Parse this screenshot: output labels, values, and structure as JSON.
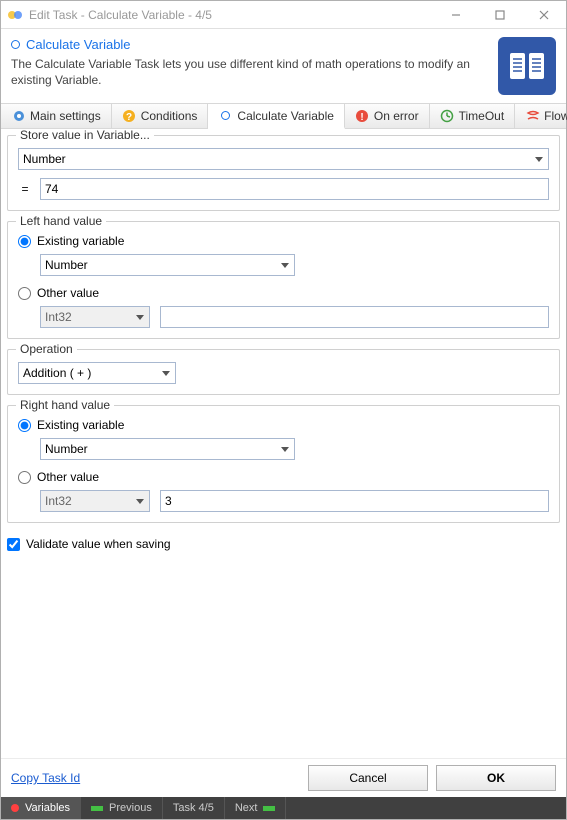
{
  "window": {
    "title": "Edit Task - Calculate Variable - 4/5"
  },
  "header": {
    "title": "Calculate Variable",
    "description": "The Calculate Variable Task lets you use different kind of math operations to modify an existing Variable."
  },
  "tabs": {
    "main": "Main settings",
    "conditions": "Conditions",
    "calc": "Calculate Variable",
    "onerror": "On error",
    "timeout": "TimeOut",
    "flow": "Flow"
  },
  "store": {
    "legend": "Store value in Variable...",
    "variable": "Number",
    "eq": "=",
    "value": "74"
  },
  "left": {
    "legend": "Left hand value",
    "existing_label": "Existing variable",
    "other_label": "Other value",
    "existing_var": "Number",
    "other_type": "Int32",
    "other_value": ""
  },
  "operation": {
    "legend": "Operation",
    "value": "Addition ( + )"
  },
  "right": {
    "legend": "Right hand value",
    "existing_label": "Existing variable",
    "other_label": "Other value",
    "existing_var": "Number",
    "other_type": "Int32",
    "other_value": "3"
  },
  "validate_label": "Validate value when saving",
  "footer": {
    "copy": "Copy Task Id",
    "cancel": "Cancel",
    "ok": "OK"
  },
  "status": {
    "variables": "Variables",
    "previous": "Previous",
    "task": "Task 4/5",
    "next": "Next"
  }
}
